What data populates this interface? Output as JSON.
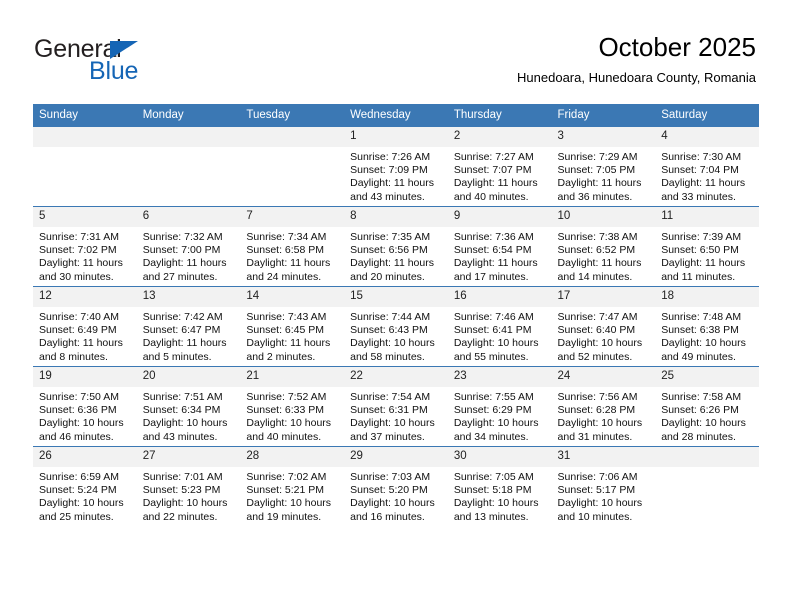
{
  "brand": {
    "word_one": "General",
    "word_two": "Blue",
    "accent_color": "#1565b5"
  },
  "header": {
    "title": "October 2025",
    "subtitle": "Hunedoara, Hunedoara County, Romania"
  },
  "calendar": {
    "header_color": "#3b78b4",
    "daynum_band_color": "#f2f2f2",
    "weekdays": [
      "Sunday",
      "Monday",
      "Tuesday",
      "Wednesday",
      "Thursday",
      "Friday",
      "Saturday"
    ],
    "weeks": [
      [
        {
          "day": "",
          "empty": true
        },
        {
          "day": "",
          "empty": true
        },
        {
          "day": "",
          "empty": true
        },
        {
          "day": "1",
          "sunrise": "Sunrise: 7:26 AM",
          "sunset": "Sunset: 7:09 PM",
          "daylight_line1": "Daylight: 11 hours",
          "daylight_line2": "and 43 minutes."
        },
        {
          "day": "2",
          "sunrise": "Sunrise: 7:27 AM",
          "sunset": "Sunset: 7:07 PM",
          "daylight_line1": "Daylight: 11 hours",
          "daylight_line2": "and 40 minutes."
        },
        {
          "day": "3",
          "sunrise": "Sunrise: 7:29 AM",
          "sunset": "Sunset: 7:05 PM",
          "daylight_line1": "Daylight: 11 hours",
          "daylight_line2": "and 36 minutes."
        },
        {
          "day": "4",
          "sunrise": "Sunrise: 7:30 AM",
          "sunset": "Sunset: 7:04 PM",
          "daylight_line1": "Daylight: 11 hours",
          "daylight_line2": "and 33 minutes."
        }
      ],
      [
        {
          "day": "5",
          "sunrise": "Sunrise: 7:31 AM",
          "sunset": "Sunset: 7:02 PM",
          "daylight_line1": "Daylight: 11 hours",
          "daylight_line2": "and 30 minutes."
        },
        {
          "day": "6",
          "sunrise": "Sunrise: 7:32 AM",
          "sunset": "Sunset: 7:00 PM",
          "daylight_line1": "Daylight: 11 hours",
          "daylight_line2": "and 27 minutes."
        },
        {
          "day": "7",
          "sunrise": "Sunrise: 7:34 AM",
          "sunset": "Sunset: 6:58 PM",
          "daylight_line1": "Daylight: 11 hours",
          "daylight_line2": "and 24 minutes."
        },
        {
          "day": "8",
          "sunrise": "Sunrise: 7:35 AM",
          "sunset": "Sunset: 6:56 PM",
          "daylight_line1": "Daylight: 11 hours",
          "daylight_line2": "and 20 minutes."
        },
        {
          "day": "9",
          "sunrise": "Sunrise: 7:36 AM",
          "sunset": "Sunset: 6:54 PM",
          "daylight_line1": "Daylight: 11 hours",
          "daylight_line2": "and 17 minutes."
        },
        {
          "day": "10",
          "sunrise": "Sunrise: 7:38 AM",
          "sunset": "Sunset: 6:52 PM",
          "daylight_line1": "Daylight: 11 hours",
          "daylight_line2": "and 14 minutes."
        },
        {
          "day": "11",
          "sunrise": "Sunrise: 7:39 AM",
          "sunset": "Sunset: 6:50 PM",
          "daylight_line1": "Daylight: 11 hours",
          "daylight_line2": "and 11 minutes."
        }
      ],
      [
        {
          "day": "12",
          "sunrise": "Sunrise: 7:40 AM",
          "sunset": "Sunset: 6:49 PM",
          "daylight_line1": "Daylight: 11 hours",
          "daylight_line2": "and 8 minutes."
        },
        {
          "day": "13",
          "sunrise": "Sunrise: 7:42 AM",
          "sunset": "Sunset: 6:47 PM",
          "daylight_line1": "Daylight: 11 hours",
          "daylight_line2": "and 5 minutes."
        },
        {
          "day": "14",
          "sunrise": "Sunrise: 7:43 AM",
          "sunset": "Sunset: 6:45 PM",
          "daylight_line1": "Daylight: 11 hours",
          "daylight_line2": "and 2 minutes."
        },
        {
          "day": "15",
          "sunrise": "Sunrise: 7:44 AM",
          "sunset": "Sunset: 6:43 PM",
          "daylight_line1": "Daylight: 10 hours",
          "daylight_line2": "and 58 minutes."
        },
        {
          "day": "16",
          "sunrise": "Sunrise: 7:46 AM",
          "sunset": "Sunset: 6:41 PM",
          "daylight_line1": "Daylight: 10 hours",
          "daylight_line2": "and 55 minutes."
        },
        {
          "day": "17",
          "sunrise": "Sunrise: 7:47 AM",
          "sunset": "Sunset: 6:40 PM",
          "daylight_line1": "Daylight: 10 hours",
          "daylight_line2": "and 52 minutes."
        },
        {
          "day": "18",
          "sunrise": "Sunrise: 7:48 AM",
          "sunset": "Sunset: 6:38 PM",
          "daylight_line1": "Daylight: 10 hours",
          "daylight_line2": "and 49 minutes."
        }
      ],
      [
        {
          "day": "19",
          "sunrise": "Sunrise: 7:50 AM",
          "sunset": "Sunset: 6:36 PM",
          "daylight_line1": "Daylight: 10 hours",
          "daylight_line2": "and 46 minutes."
        },
        {
          "day": "20",
          "sunrise": "Sunrise: 7:51 AM",
          "sunset": "Sunset: 6:34 PM",
          "daylight_line1": "Daylight: 10 hours",
          "daylight_line2": "and 43 minutes."
        },
        {
          "day": "21",
          "sunrise": "Sunrise: 7:52 AM",
          "sunset": "Sunset: 6:33 PM",
          "daylight_line1": "Daylight: 10 hours",
          "daylight_line2": "and 40 minutes."
        },
        {
          "day": "22",
          "sunrise": "Sunrise: 7:54 AM",
          "sunset": "Sunset: 6:31 PM",
          "daylight_line1": "Daylight: 10 hours",
          "daylight_line2": "and 37 minutes."
        },
        {
          "day": "23",
          "sunrise": "Sunrise: 7:55 AM",
          "sunset": "Sunset: 6:29 PM",
          "daylight_line1": "Daylight: 10 hours",
          "daylight_line2": "and 34 minutes."
        },
        {
          "day": "24",
          "sunrise": "Sunrise: 7:56 AM",
          "sunset": "Sunset: 6:28 PM",
          "daylight_line1": "Daylight: 10 hours",
          "daylight_line2": "and 31 minutes."
        },
        {
          "day": "25",
          "sunrise": "Sunrise: 7:58 AM",
          "sunset": "Sunset: 6:26 PM",
          "daylight_line1": "Daylight: 10 hours",
          "daylight_line2": "and 28 minutes."
        }
      ],
      [
        {
          "day": "26",
          "sunrise": "Sunrise: 6:59 AM",
          "sunset": "Sunset: 5:24 PM",
          "daylight_line1": "Daylight: 10 hours",
          "daylight_line2": "and 25 minutes."
        },
        {
          "day": "27",
          "sunrise": "Sunrise: 7:01 AM",
          "sunset": "Sunset: 5:23 PM",
          "daylight_line1": "Daylight: 10 hours",
          "daylight_line2": "and 22 minutes."
        },
        {
          "day": "28",
          "sunrise": "Sunrise: 7:02 AM",
          "sunset": "Sunset: 5:21 PM",
          "daylight_line1": "Daylight: 10 hours",
          "daylight_line2": "and 19 minutes."
        },
        {
          "day": "29",
          "sunrise": "Sunrise: 7:03 AM",
          "sunset": "Sunset: 5:20 PM",
          "daylight_line1": "Daylight: 10 hours",
          "daylight_line2": "and 16 minutes."
        },
        {
          "day": "30",
          "sunrise": "Sunrise: 7:05 AM",
          "sunset": "Sunset: 5:18 PM",
          "daylight_line1": "Daylight: 10 hours",
          "daylight_line2": "and 13 minutes."
        },
        {
          "day": "31",
          "sunrise": "Sunrise: 7:06 AM",
          "sunset": "Sunset: 5:17 PM",
          "daylight_line1": "Daylight: 10 hours",
          "daylight_line2": "and 10 minutes."
        },
        {
          "day": "",
          "empty": true
        }
      ]
    ]
  }
}
